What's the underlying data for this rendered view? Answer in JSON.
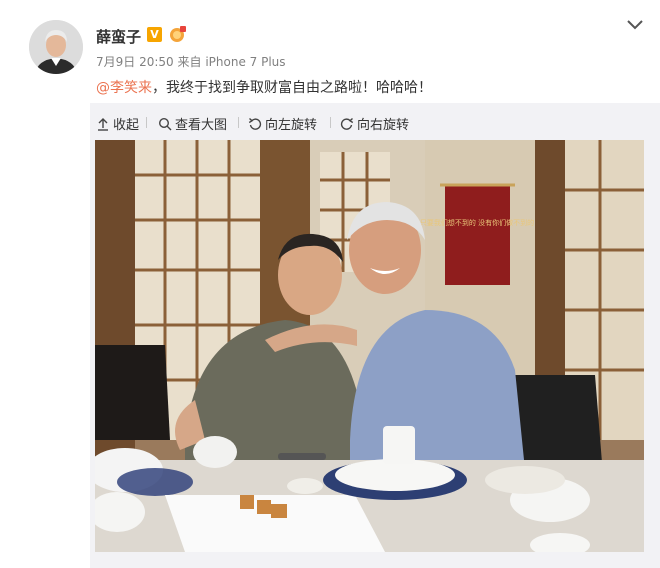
{
  "author": {
    "name": "薛蛮子",
    "verified_badge": "V",
    "avatar_icon": "avatar-portrait",
    "medal_icon": "medal-icon"
  },
  "meta": {
    "timestamp": "7月9日 20:50",
    "source_prefix": "来自",
    "device": "iPhone 7 Plus"
  },
  "post": {
    "mention": "@李笑来",
    "text": "，我终于找到争取财富自由之路啦！哈哈哈！"
  },
  "toolbar": {
    "collapse_label": "收起",
    "view_large_label": "查看大图",
    "rotate_left_label": "向左旋转",
    "rotate_right_label": "向右旋转"
  },
  "photo": {
    "scroll_text": "只要我们想不到的 没有你们做不到的"
  },
  "colors": {
    "link": "#eb7350",
    "verified": "#f7a500",
    "panel_bg": "#f2f2f5"
  }
}
